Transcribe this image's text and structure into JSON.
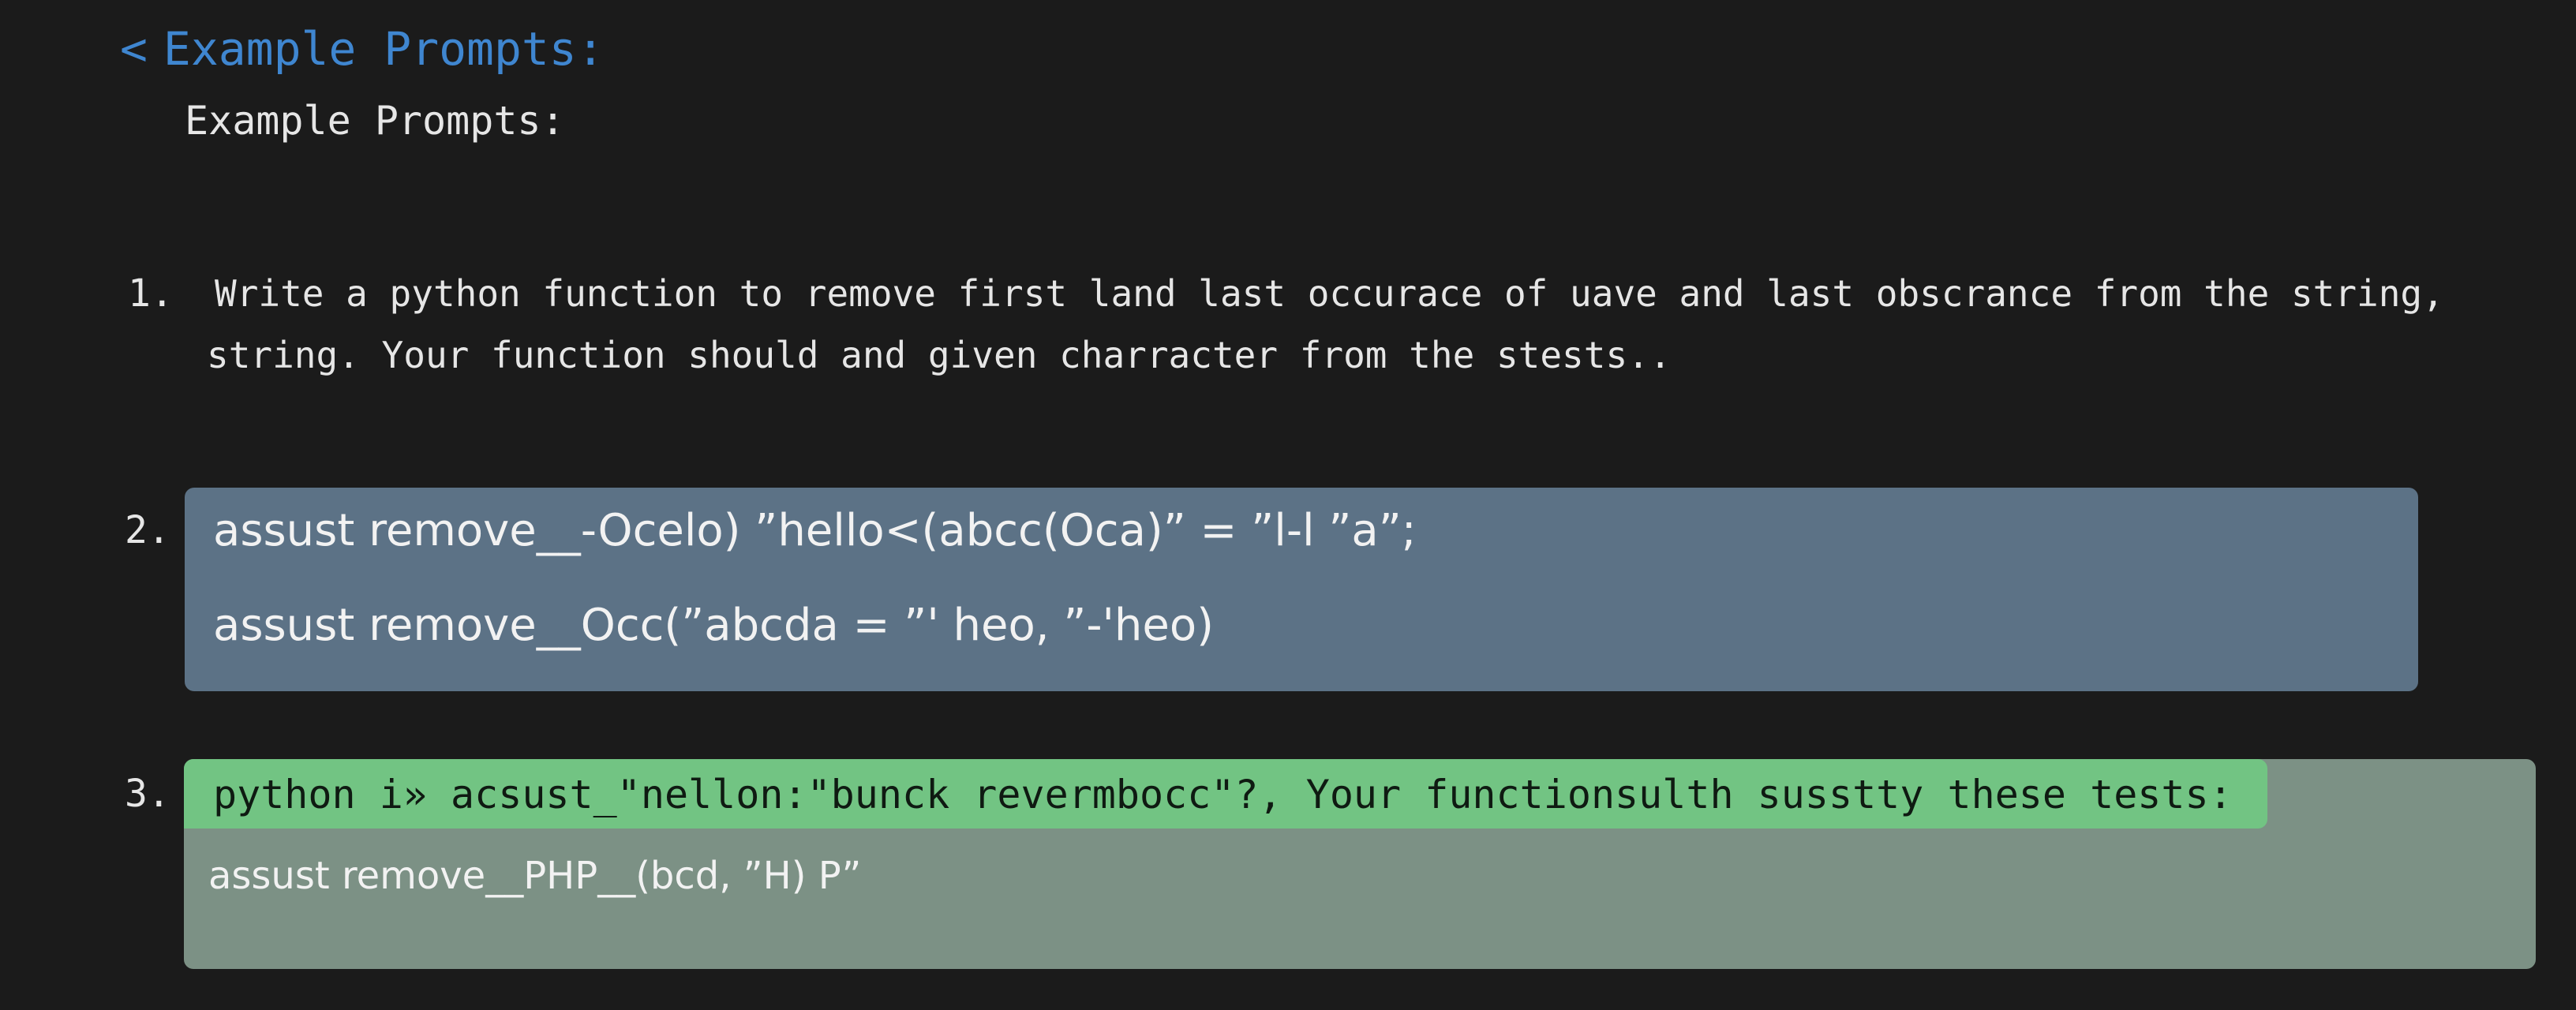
{
  "header": {
    "back_icon": "<",
    "back_label": "Example Prompts:",
    "subtitle": "Example Prompts:"
  },
  "items": [
    {
      "number": "1.",
      "lines": [
        "Write a python function to remove first land last occurace of uave and last obscrance from the string,",
        "string. Your function should and given charracter from the stests.."
      ]
    },
    {
      "number": "2.",
      "lines": [
        "assust remove__-Ocelo) ”hello<(abcc(Oca)” = ”l-l ”a”;",
        "assust remove__Occ(”abcda  =  ”' heo, ”-'heo)"
      ]
    },
    {
      "number": "3.",
      "highlight": "python i» acsust_\"nellon:\"bunck revermbocc\"?, Your functionsulth susstty these tests:",
      "lines": [
        "assust remove__PHP__(bcd, ”H) P”"
      ]
    }
  ],
  "colors": {
    "background": "#1b1b1b",
    "link": "#3f86d0",
    "block2": "#5c7286",
    "block3": "#7c9185",
    "highlight": "#72c483"
  }
}
